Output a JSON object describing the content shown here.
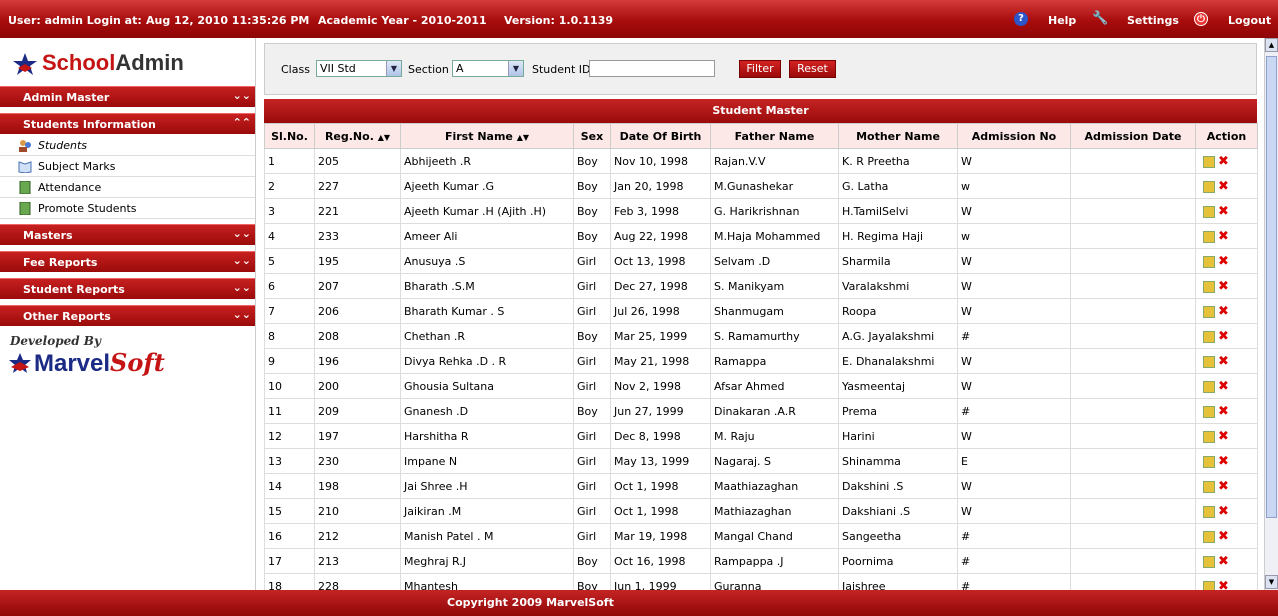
{
  "header": {
    "user": "User: admin Login at:",
    "login_time": "Aug 12, 2010 11:35:26 PM",
    "academic_year": "Academic Year - 2010-2011",
    "version": "Version: 1.0.1139",
    "help": "Help",
    "settings": "Settings",
    "logout": "Logout"
  },
  "logo": {
    "school": "School",
    "admin": "Admin"
  },
  "sidebar": {
    "admin_master": "Admin Master",
    "students_information": "Students Information",
    "sub_items": [
      "Students",
      "Subject Marks",
      "Attendance",
      "Promote Students"
    ],
    "masters": "Masters",
    "fee_reports": "Fee Reports",
    "student_reports": "Student Reports",
    "other_reports": "Other Reports",
    "developed_by": "Developed By",
    "marvel": "Marvel",
    "soft": "Soft"
  },
  "filter": {
    "class_label": "Class",
    "class_value": "VII Std",
    "section_label": "Section",
    "section_value": "A",
    "student_id_label": "Student ID",
    "student_id_value": "",
    "filter_button": "Filter",
    "reset_button": "Reset"
  },
  "grid": {
    "title": "Student Master",
    "columns": [
      "Sl.No.",
      "Reg.No.",
      "First Name",
      "Sex",
      "Date Of Birth",
      "Father Name",
      "Mother Name",
      "Admission No",
      "Admission Date",
      "Action"
    ],
    "rows": [
      [
        "1",
        "205",
        "Abhijeeth .R",
        "Boy",
        "Nov 10, 1998",
        "Rajan.V.V",
        "K. R Preetha",
        "W",
        ""
      ],
      [
        "2",
        "227",
        "Ajeeth Kumar .G",
        "Boy",
        "Jan 20, 1998",
        "M.Gunashekar",
        "G. Latha",
        "w",
        ""
      ],
      [
        "3",
        "221",
        "Ajeeth Kumar .H (Ajith .H)",
        "Boy",
        "Feb 3, 1998",
        "G. Harikrishnan",
        "H.TamilSelvi",
        "W",
        ""
      ],
      [
        "4",
        "233",
        "Ameer Ali",
        "Boy",
        "Aug 22, 1998",
        "M.Haja Mohammed",
        "H. Regima Haji",
        "w",
        ""
      ],
      [
        "5",
        "195",
        "Anusuya .S",
        "Girl",
        "Oct 13, 1998",
        "Selvam .D",
        "Sharmila",
        "W",
        ""
      ],
      [
        "6",
        "207",
        "Bharath .S.M",
        "Girl",
        "Dec 27, 1998",
        "S. Manikyam",
        "Varalakshmi",
        "W",
        ""
      ],
      [
        "7",
        "206",
        "Bharath Kumar . S",
        "Girl",
        "Jul 26, 1998",
        "Shanmugam",
        "Roopa",
        "W",
        ""
      ],
      [
        "8",
        "208",
        "Chethan .R",
        "Boy",
        "Mar 25, 1999",
        "S. Ramamurthy",
        "A.G. Jayalakshmi",
        "#",
        ""
      ],
      [
        "9",
        "196",
        "Divya Rehka .D . R",
        "Girl",
        "May 21, 1998",
        "Ramappa",
        "E. Dhanalakshmi",
        "W",
        ""
      ],
      [
        "10",
        "200",
        "Ghousia Sultana",
        "Girl",
        "Nov 2, 1998",
        "Afsar Ahmed",
        "Yasmeentaj",
        "W",
        ""
      ],
      [
        "11",
        "209",
        "Gnanesh .D",
        "Boy",
        "Jun 27, 1999",
        "Dinakaran .A.R",
        "Prema",
        "#",
        ""
      ],
      [
        "12",
        "197",
        "Harshitha R",
        "Girl",
        "Dec 8, 1998",
        "M. Raju",
        "Harini",
        "W",
        ""
      ],
      [
        "13",
        "230",
        "Impane N",
        "Girl",
        "May 13, 1999",
        "Nagaraj. S",
        "Shinamma",
        "E",
        ""
      ],
      [
        "14",
        "198",
        "Jai Shree .H",
        "Girl",
        "Oct 1, 1998",
        "Maathiazaghan",
        "Dakshini .S",
        "W",
        ""
      ],
      [
        "15",
        "210",
        "Jaikiran .M",
        "Girl",
        "Oct 1, 1998",
        "Mathiazaghan",
        "Dakshiani .S",
        "W",
        ""
      ],
      [
        "16",
        "212",
        "Manish Patel . M",
        "Girl",
        "Mar 19, 1998",
        "Mangal Chand",
        "Sangeetha",
        "#",
        ""
      ],
      [
        "17",
        "213",
        "Meghraj R.J",
        "Boy",
        "Oct 16, 1998",
        "Rampappa .J",
        "Poornima",
        "#",
        ""
      ],
      [
        "18",
        "228",
        "Mhantesh",
        "Boy",
        "Jun 1, 1999",
        "Guranna",
        "Jaishree",
        "#",
        ""
      ]
    ]
  },
  "footer": {
    "copyright": "Copyright 2009 MarvelSoft"
  }
}
